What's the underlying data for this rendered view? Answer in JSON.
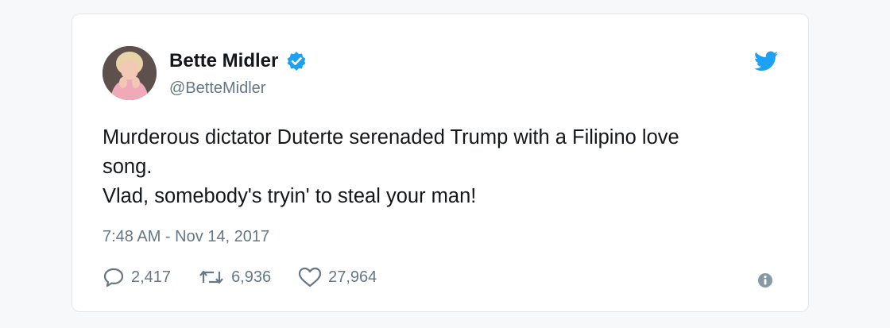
{
  "tweet": {
    "author": {
      "name": "Bette Midler",
      "handle": "@BetteMidler",
      "verified": true,
      "avatar_icon": "profile-photo"
    },
    "brand": {
      "icon": "twitter-bird-icon",
      "color": "#1da1f2"
    },
    "text_lines": [
      "Murderous dictator Duterte serenaded Trump with a Filipino love",
      "song.",
      "Vlad, somebody's tryin' to steal your man!"
    ],
    "timestamp": "7:48 AM - Nov 14, 2017",
    "actions": {
      "replies": "2,417",
      "retweets": "6,936",
      "likes": "27,964"
    },
    "info_icon": "info-icon"
  }
}
